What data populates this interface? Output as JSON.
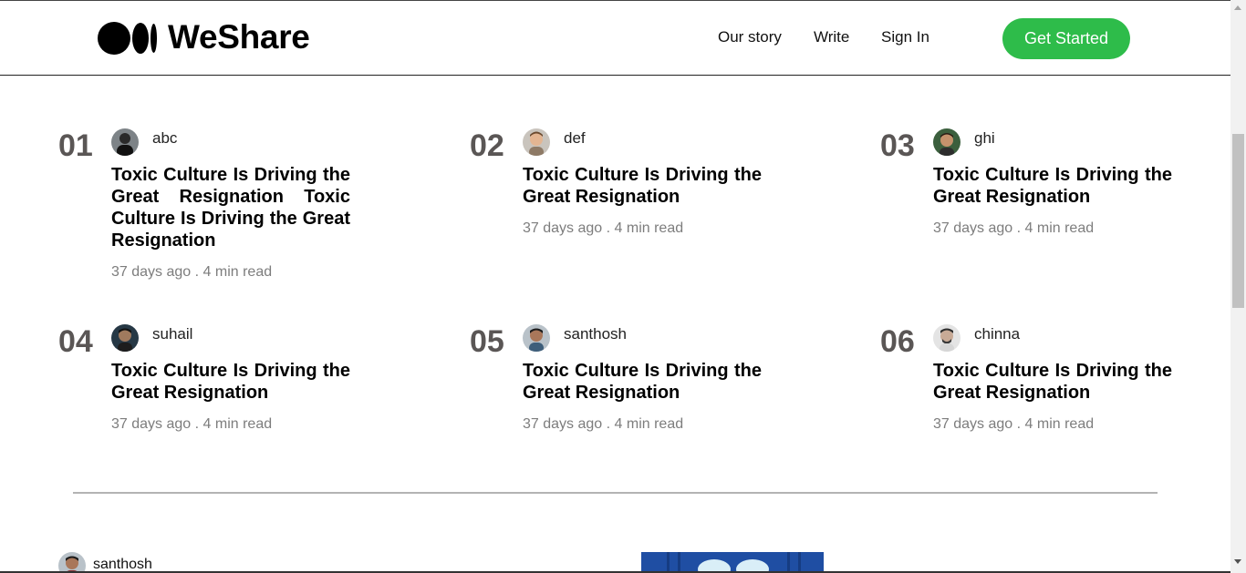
{
  "header": {
    "brand": "WeShare",
    "logo_icon": "medium-logo-icon",
    "nav": [
      "Our story",
      "Write",
      "Sign In"
    ],
    "cta_label": "Get Started",
    "cta_color": "#2ebc4a"
  },
  "trending": [
    {
      "num": "01",
      "author": "abc",
      "title": "Toxic Culture Is Driving the Great Resignation Toxic Culture Is Driving the Great Resignation",
      "meta": "37 days ago . 4 min read"
    },
    {
      "num": "02",
      "author": "def",
      "title": "Toxic Culture Is Driving the Great Resignation",
      "meta": "37 days ago . 4 min read"
    },
    {
      "num": "03",
      "author": "ghi",
      "title": "Toxic Culture Is Driving the Great Resignation",
      "meta": "37 days ago . 4 min read"
    },
    {
      "num": "04",
      "author": "suhail",
      "title": "Toxic Culture Is Driving the Great Resignation",
      "meta": "37 days ago . 4 min read"
    },
    {
      "num": "05",
      "author": "santhosh",
      "title": "Toxic Culture Is Driving the Great Resignation",
      "meta": "37 days ago . 4 min read"
    },
    {
      "num": "06",
      "author": "chinna",
      "title": "Toxic Culture Is Driving the Great Resignation",
      "meta": "37 days ago . 4 min read"
    }
  ],
  "feed": {
    "first_post_author": "santhosh"
  }
}
